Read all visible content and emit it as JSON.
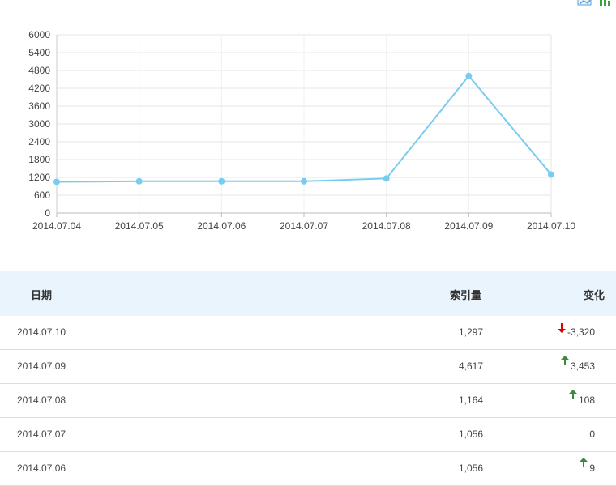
{
  "toolbar": {
    "line_chart_icon": "line-chart-icon",
    "bar_chart_icon": "bar-chart-icon"
  },
  "chart_data": {
    "type": "line",
    "x": [
      "2014.07.04",
      "2014.07.05",
      "2014.07.06",
      "2014.07.07",
      "2014.07.08",
      "2014.07.09",
      "2014.07.10"
    ],
    "series": [
      {
        "values": [
          1050,
          1070,
          1070,
          1070,
          1164,
          4617,
          1297
        ],
        "color": "#77ccf0"
      }
    ],
    "y_ticks": [
      "0",
      "600",
      "1200",
      "1800",
      "2400",
      "3000",
      "3600",
      "4200",
      "4800",
      "5400",
      "6000"
    ],
    "ylim": [
      0,
      6000
    ],
    "grid": true,
    "legend": "none"
  },
  "table": {
    "headers": {
      "date": "日期",
      "volume": "索引量",
      "change": "变化"
    },
    "rows": [
      {
        "date": "2014.07.10",
        "volume": "1,297",
        "change": "-3,320",
        "direction": "down"
      },
      {
        "date": "2014.07.09",
        "volume": "4,617",
        "change": "3,453",
        "direction": "up"
      },
      {
        "date": "2014.07.08",
        "volume": "1,164",
        "change": "108",
        "direction": "up"
      },
      {
        "date": "2014.07.07",
        "volume": "1,056",
        "change": "0",
        "direction": "none"
      },
      {
        "date": "2014.07.06",
        "volume": "1,056",
        "change": "9",
        "direction": "up"
      }
    ]
  },
  "colors": {
    "up": "#3a8a3a",
    "down": "#e00000",
    "line": "#77ccf0",
    "header_bg": "#e9f4fd"
  }
}
